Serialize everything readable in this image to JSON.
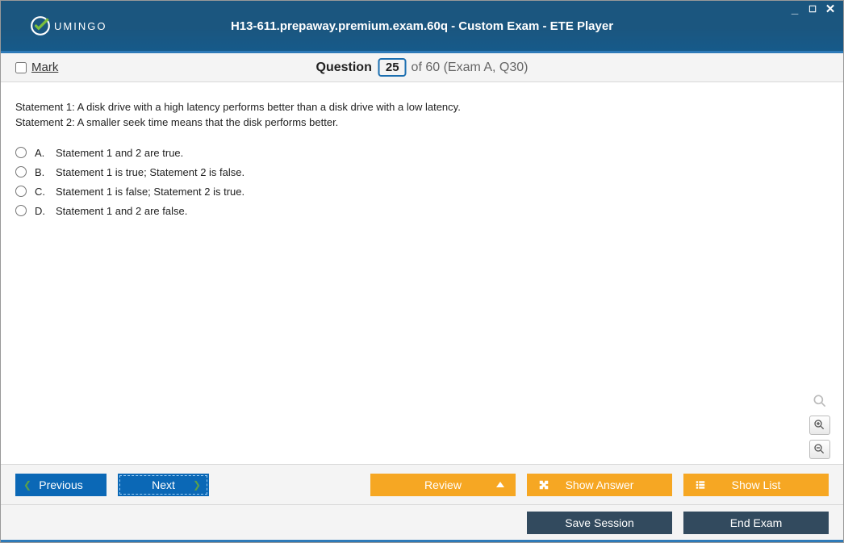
{
  "window": {
    "title": "H13-611.prepaway.premium.exam.60q - Custom Exam - ETE Player",
    "logo_text": "UMINGO"
  },
  "header": {
    "mark_label": "Mark",
    "question_word": "Question",
    "current": "25",
    "total_text": "of 60 (Exam A, Q30)"
  },
  "question": {
    "statement1": "Statement 1: A disk drive with a high latency performs better than a disk drive with a low latency.",
    "statement2": "Statement 2: A smaller seek time means that the disk performs better.",
    "options": [
      {
        "letter": "A.",
        "text": "Statement 1 and 2 are true."
      },
      {
        "letter": "B.",
        "text": "Statement 1 is true; Statement 2 is false."
      },
      {
        "letter": "C.",
        "text": "Statement 1 is false; Statement 2 is true."
      },
      {
        "letter": "D.",
        "text": "Statement 1 and 2 are false."
      }
    ]
  },
  "buttons": {
    "previous": "Previous",
    "next": "Next",
    "review": "Review",
    "show_answer": "Show Answer",
    "show_list": "Show List",
    "save_session": "Save Session",
    "end_exam": "End Exam"
  }
}
